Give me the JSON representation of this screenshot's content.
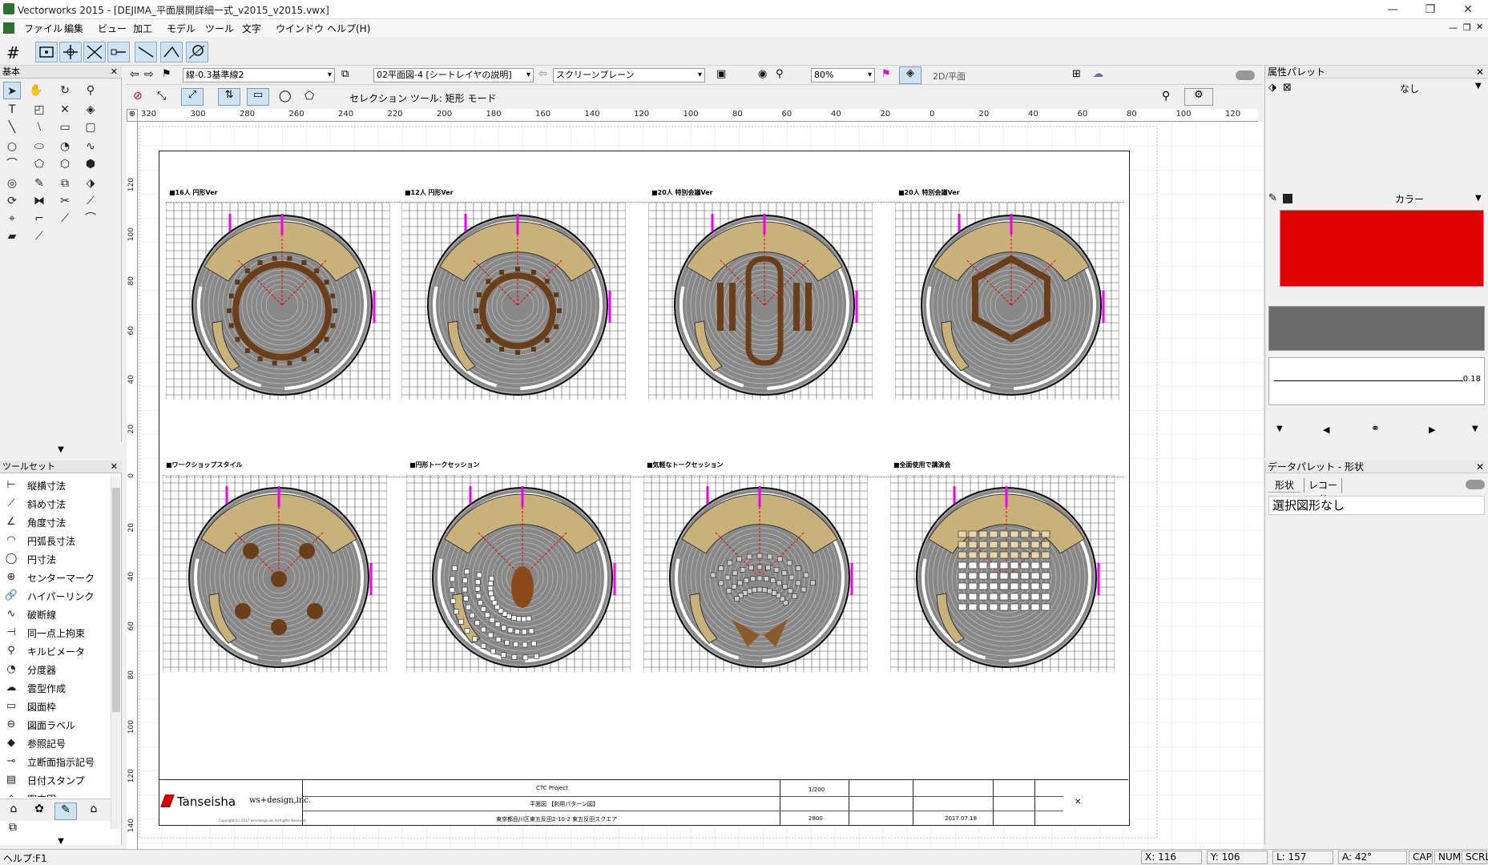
{
  "window": {
    "title": "Vectorworks 2015 - [DEJIMA_平面展開詳細一式_v2015_v2015.vwx]",
    "minimize": "—",
    "restore": "❐",
    "close": "✕"
  },
  "menu": [
    "ファイル",
    "編集",
    "ビュー",
    "加工",
    "モデル",
    "ツール",
    "文字",
    "ウインドウ",
    "ヘルプ(H)"
  ],
  "palettes": {
    "basic": "基本",
    "toolset": "ツールセット",
    "toolset_items": [
      "縦横寸法",
      "斜め寸法",
      "角度寸法",
      "円弧長寸法",
      "円寸法",
      "センターマーク",
      "ハイパーリンク",
      "破断線",
      "同一点上拘束",
      "キルビメータ",
      "分度器",
      "雲型作成",
      "図面枠",
      "図面ラベル",
      "参照記号",
      "立断面指示記号",
      "日付スタンプ",
      "案内図"
    ],
    "toolset_icons": [
      "dim-icon",
      "dim-angle-icon",
      "angle-icon",
      "arc-dim-icon",
      "circle-dim-icon",
      "center-mark-icon",
      "link-icon",
      "break-line-icon",
      "constraint-icon",
      "measure-icon",
      "protractor-icon",
      "cloud-icon",
      "frame-icon",
      "label-icon",
      "reference-icon",
      "section-icon",
      "stamp-icon",
      "guide-icon"
    ]
  },
  "viewbar": {
    "class": "線-0.3基準線2",
    "layer": "02平面図-4 [シートレイヤの説明]",
    "plane": "スクリーンプレーン",
    "zoom": "80%",
    "view": "2D/平面"
  },
  "modebar": {
    "mode_text": "セレクション ツール: 矩形 モード"
  },
  "ruler": {
    "top": [
      "320",
      "300",
      "280",
      "260",
      "240",
      "220",
      "200",
      "180",
      "160",
      "140",
      "120",
      "100",
      "80",
      "60",
      "40",
      "20",
      "0",
      "20",
      "40",
      "60",
      "80",
      "100",
      "120"
    ],
    "left": [
      "120",
      "100",
      "80",
      "60",
      "40",
      "20",
      "0",
      "20",
      "40",
      "60",
      "80",
      "100",
      "120",
      "140"
    ]
  },
  "sheet": {
    "plans": [
      {
        "label": "■16人 円形Ver"
      },
      {
        "label": "■12人 円形Ver"
      },
      {
        "label": "■20人 特別会議Ver"
      },
      {
        "label": "■20人 特別会議Ver"
      },
      {
        "label": "■ワークショップスタイル"
      },
      {
        "label": "■円形トークセッション"
      },
      {
        "label": "■気軽なトークセッション"
      },
      {
        "label": "■全面使用で講演会"
      }
    ],
    "titleblock": {
      "company": "Tanseisha",
      "partner": "ws+design,inc.",
      "project": "CTC Project",
      "drawing": "平面図 【利用パターン図】",
      "address": "東京都品川区東五反田2-10-2 東五反田スクエア",
      "scale": "1/200",
      "number": "2800",
      "date": "2017.07.18",
      "copyright": "Copyright (C) 2017 ws+design,inc All Rights Reserved"
    }
  },
  "attributes": {
    "title": "属性パレット",
    "fill_value": "なし",
    "pen_value": "カラー",
    "line_weight": "0.18",
    "fill_color": "#e00000",
    "pen_color": "#6b6b6b"
  },
  "data_palette": {
    "title": "データパレット - 形状",
    "tabs": [
      "形状",
      "レコード"
    ],
    "message": "選択図形なし"
  },
  "status": {
    "help": "ヘルプ:F1",
    "x": "X: 116",
    "y": "Y: 106",
    "l": "L: 157",
    "a": "A: 42°",
    "caps": "CAP",
    "num": "NUM",
    "scrl": "SCRL"
  }
}
